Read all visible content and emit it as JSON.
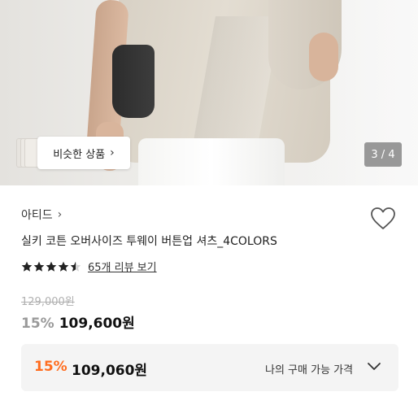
{
  "hero": {
    "similar_label": "비슷한 상품",
    "page_counter": "3 / 4"
  },
  "product": {
    "brand": "아티드",
    "title": "실키 코튼 오버사이즈 투웨이 버튼업 셔츠_4COLORS",
    "rating_stars": 4.5,
    "review_link": "65개 리뷰 보기",
    "original_price": "129,000원",
    "discount_rate": "15%",
    "sale_price": "109,600원"
  },
  "my_price": {
    "discount_rate": "15%",
    "price": "109,060원",
    "label": "나의 구매 가능 가격"
  },
  "colors": {
    "orange_accent": "#ff6d1f",
    "grey_discount": "#9a9a9a",
    "panel_bg": "#f4f4f4"
  },
  "icons": [
    "chevron-right-icon",
    "heart-icon",
    "star-icon",
    "chevron-down-icon"
  ]
}
